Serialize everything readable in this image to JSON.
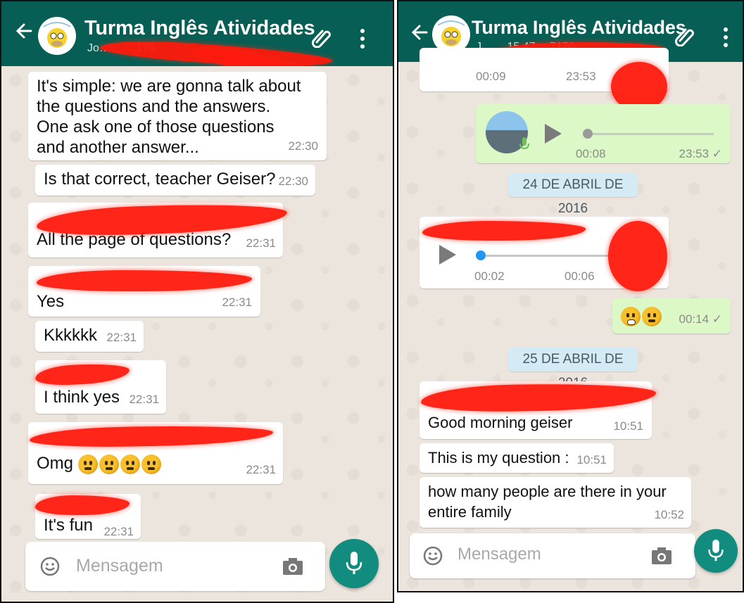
{
  "left": {
    "header": {
      "title": "Turma Inglês Atividades",
      "subtitle": "Jo… ……176"
    },
    "messages": [
      {
        "text": "It's simple: we are gonna talk about the questions and the answers. One ask one of those questions and another answer...",
        "time": "22:30"
      },
      {
        "text": "Is that correct, teacher Geiser?",
        "time": "22:30"
      },
      {
        "text": "All the page of questions?",
        "time": "22:31"
      },
      {
        "text": "Yes",
        "time": "22:31"
      },
      {
        "text": "Kkkkkk",
        "time": "22:31"
      },
      {
        "text": "I think yes",
        "time": "22:31"
      },
      {
        "text": "Omg",
        "time": "22:31",
        "emoji_count": 4
      },
      {
        "text": "It's fun",
        "time": "22:31"
      }
    ],
    "input": {
      "placeholder": "Mensagem"
    }
  },
  "right": {
    "header": {
      "title": "Turma Inglês Atividades",
      "subtitle": "J… …15 47 …7176"
    },
    "audio_top": {
      "duration": "00:09",
      "time": "23:53"
    },
    "audio_out": {
      "duration": "00:08",
      "time": "23:53 ✓"
    },
    "date_1": "24 DE ABRIL DE 2016",
    "audio_in": {
      "position": "00:02",
      "duration": "00:06"
    },
    "emoji_msg": {
      "time": "00:14 ✓"
    },
    "date_2": "25 DE ABRIL DE 2016",
    "messages": [
      {
        "text": "Good morning geiser",
        "time": "10:51"
      },
      {
        "text": "This is my question :",
        "time": "10:51"
      },
      {
        "text": "how many people are there in your entire family",
        "time": "10:52"
      }
    ],
    "input": {
      "placeholder": "Mensagem"
    }
  },
  "colors": {
    "header": "#075e54",
    "accent": "#128c7e",
    "outgoing": "#dcf8c6",
    "redaction": "#ff1a0c"
  },
  "icons": [
    "back-arrow-icon",
    "paperclip-icon",
    "more-vert-icon",
    "emoji-icon",
    "camera-icon",
    "mic-icon",
    "play-icon",
    "mic-small-icon",
    "double-check-icon"
  ]
}
